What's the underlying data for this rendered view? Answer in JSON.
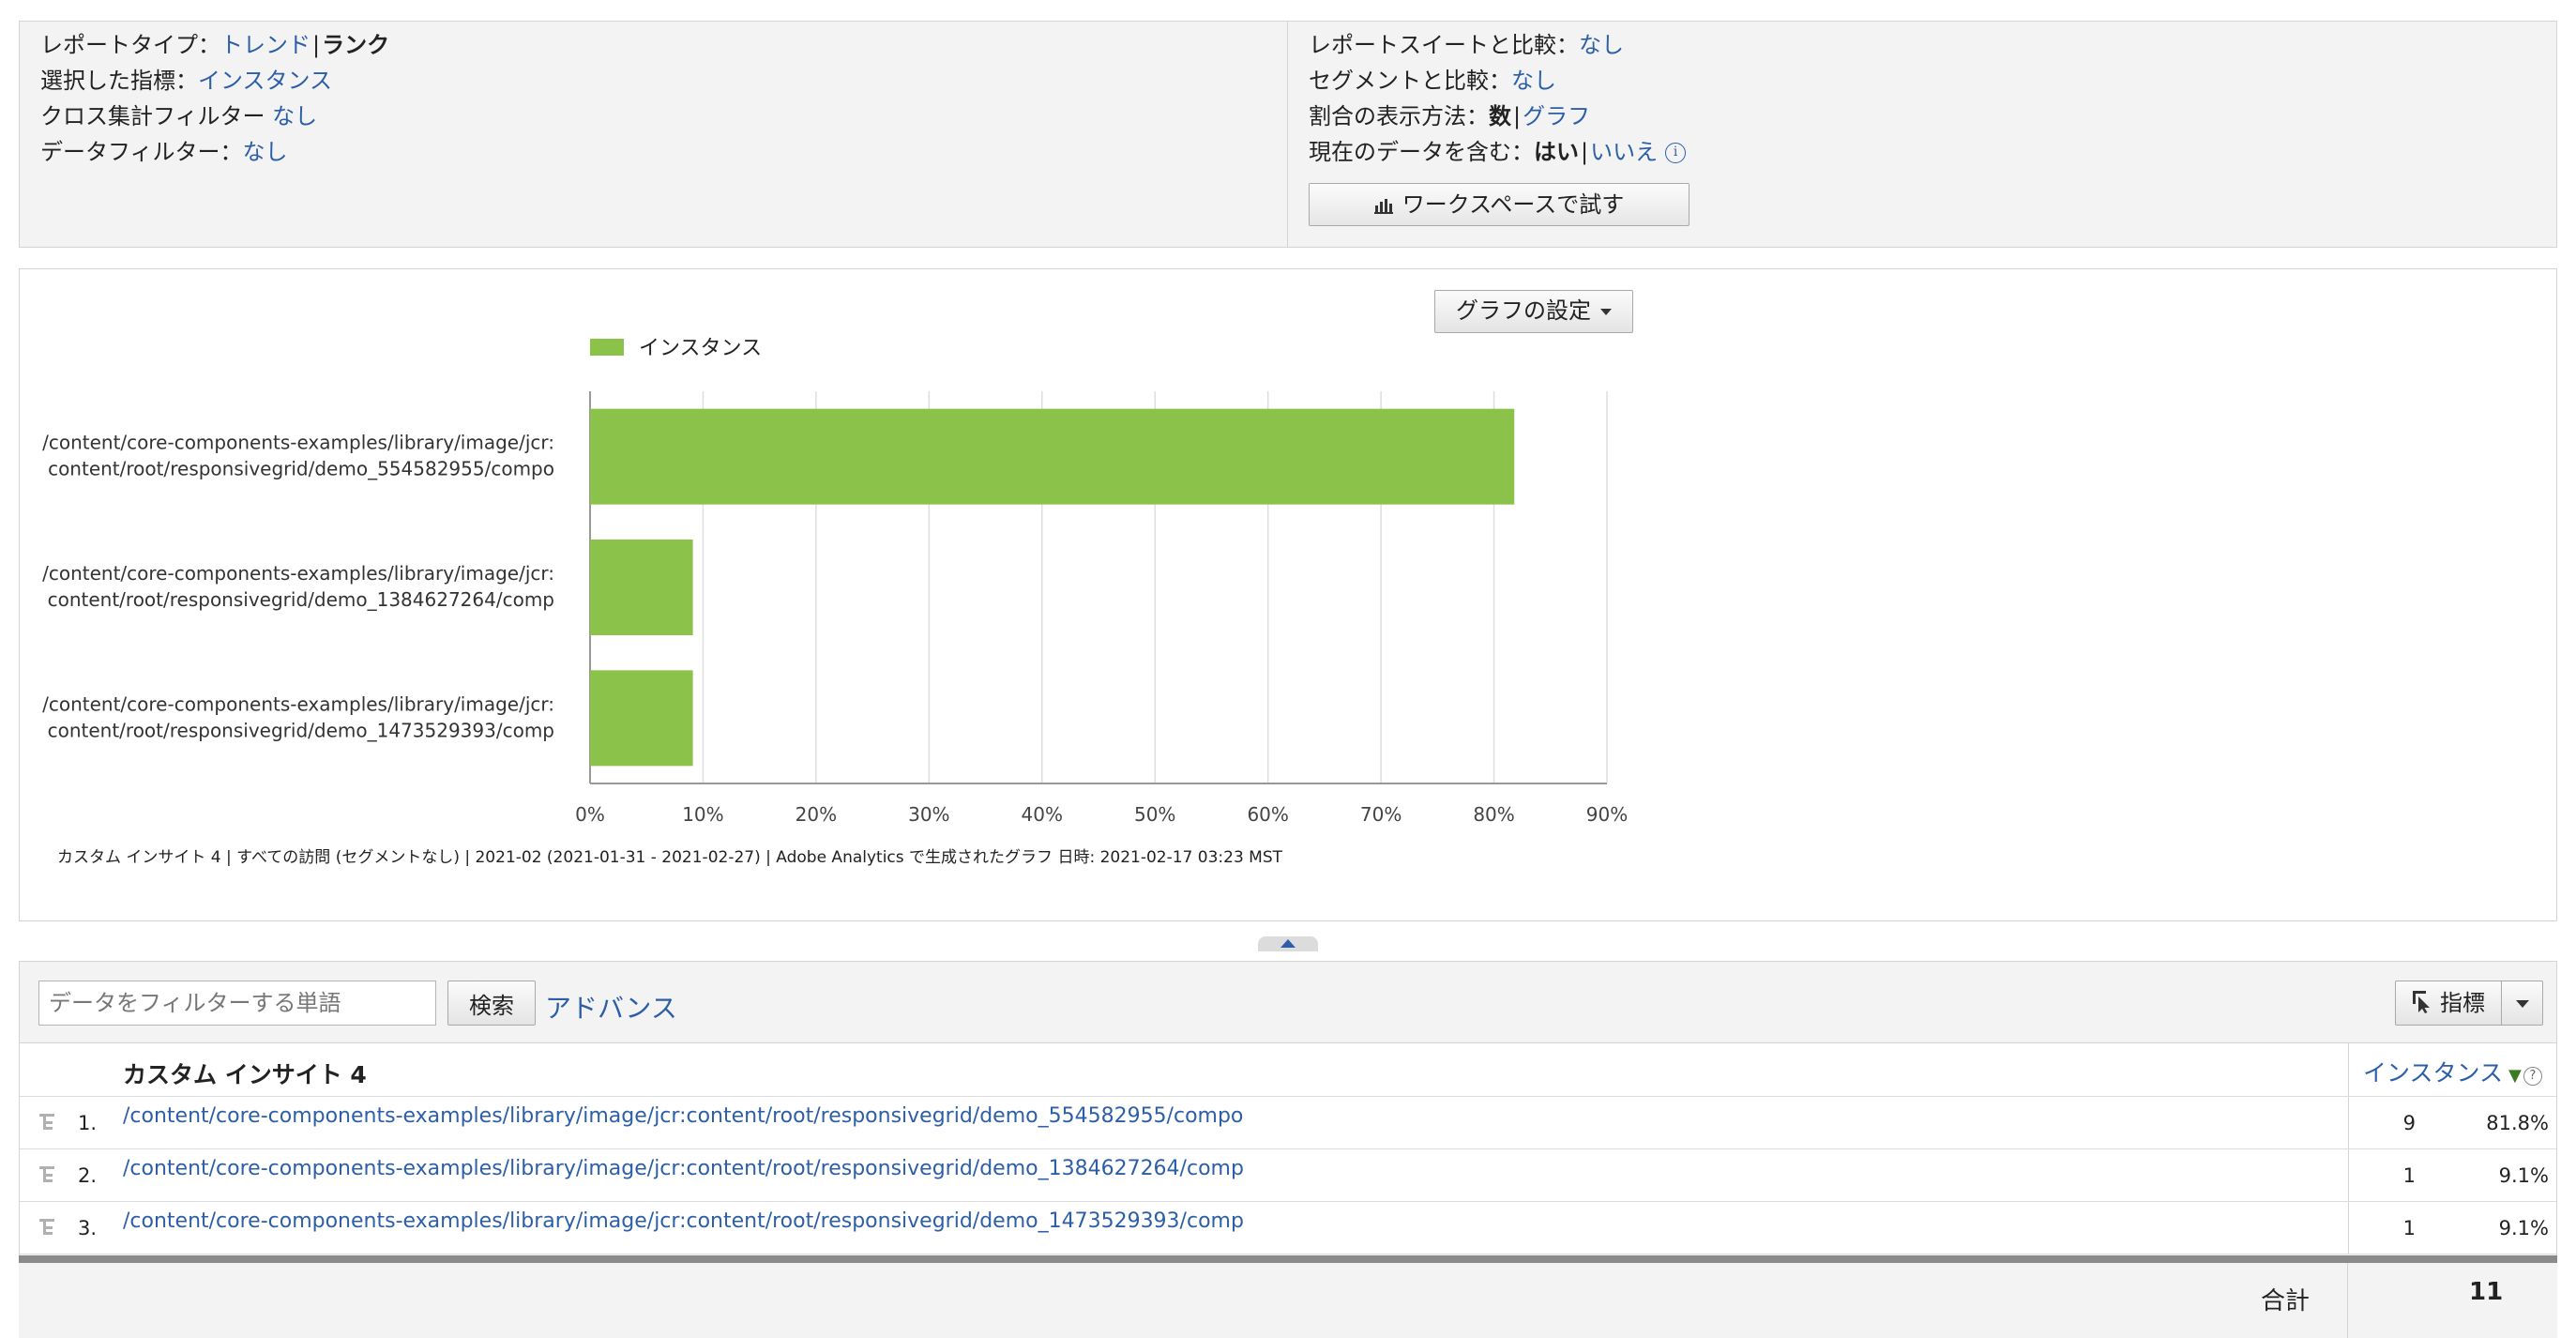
{
  "settings": {
    "report_type": {
      "label": "レポートタイプ：",
      "option_trend": "トレンド",
      "separator": "|",
      "option_rank": "ランク"
    },
    "selected_metric": {
      "label": "選択した指標：",
      "value": "インスタンス"
    },
    "crosstab_filter": {
      "label": "クロス集計フィルター",
      "value": "なし"
    },
    "data_filter": {
      "label": "データフィルター：",
      "value": "なし"
    },
    "compare_suite": {
      "label": "レポートスイートと比較：",
      "value": "なし"
    },
    "compare_segment": {
      "label": "セグメントと比較：",
      "value": "なし"
    },
    "percent_display": {
      "label": "割合の表示方法：",
      "option_number": "数",
      "separator": "|",
      "option_graph": "グラフ"
    },
    "include_current": {
      "label": "現在のデータを含む：",
      "option_yes": "はい",
      "separator": "|",
      "option_no": "いいえ"
    },
    "workspace_button": "ワークスペースで試す"
  },
  "chart_panel": {
    "graph_settings_button": "グラフの設定",
    "footer": "カスタム インサイト 4 | すべての訪問 (セグメントなし) | 2021-02 (2021-01-31 - 2021-02-27) | Adobe Analytics で生成されたグラフ 日時: 2021-02-17 03:23 MST"
  },
  "chart_data": {
    "type": "bar",
    "orientation": "horizontal",
    "categories": [
      [
        "/content/core-components-examples/library/image/jcr:",
        "content/root/responsivegrid/demo_554582955/compo"
      ],
      [
        "/content/core-components-examples/library/image/jcr:",
        "content/root/responsivegrid/demo_1384627264/comp"
      ],
      [
        "/content/core-components-examples/library/image/jcr:",
        "content/root/responsivegrid/demo_1473529393/comp"
      ]
    ],
    "series": [
      {
        "name": "インスタンス",
        "values": [
          81.8,
          9.1,
          9.1
        ]
      }
    ],
    "xlim": [
      0,
      90
    ],
    "xticks": [
      "0%",
      "10%",
      "20%",
      "30%",
      "40%",
      "50%",
      "60%",
      "70%",
      "80%",
      "90%"
    ],
    "grid": true,
    "legend": "top-left",
    "bar_color": "#8bc34a"
  },
  "table": {
    "filter_placeholder": "データをフィルターする単語",
    "search_button": "検索",
    "advanced_link": "アドバンス",
    "metrics_button": "指標",
    "header_dimension": "カスタム インサイト 4",
    "header_metric": "インスタンス",
    "sort_indicator": "▼",
    "help_icon_text": "?",
    "rows": [
      {
        "num": "1.",
        "name": "/content/core-components-examples/library/image/jcr:content/root/responsivegrid/demo_554582955/compo",
        "value": "9",
        "pct": "81.8%"
      },
      {
        "num": "2.",
        "name": "/content/core-components-examples/library/image/jcr:content/root/responsivegrid/demo_1384627264/comp",
        "value": "1",
        "pct": "9.1%"
      },
      {
        "num": "3.",
        "name": "/content/core-components-examples/library/image/jcr:content/root/responsivegrid/demo_1473529393/comp",
        "value": "1",
        "pct": "9.1%"
      }
    ],
    "total_label": "合計",
    "total_value": "11"
  },
  "colors": {
    "link": "#2d5fa8",
    "bar": "#8bc34a",
    "panel_bg": "#f3f3f3"
  }
}
